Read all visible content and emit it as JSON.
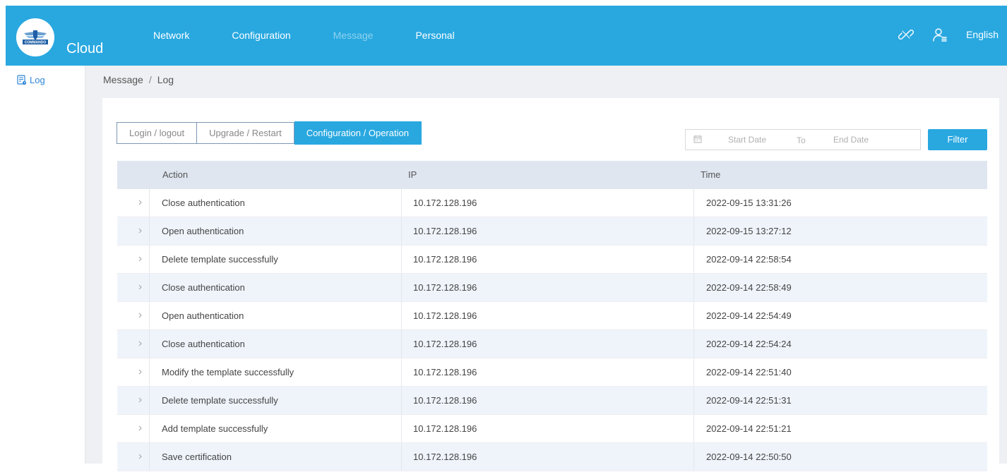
{
  "header": {
    "brand": "Cloud",
    "logo_text": "COMMANDO",
    "nav": [
      {
        "label": "Network",
        "dim": false
      },
      {
        "label": "Configuration",
        "dim": false
      },
      {
        "label": "Message",
        "dim": true
      },
      {
        "label": "Personal",
        "dim": false
      }
    ],
    "icons": [
      "link-icon",
      "user-icon"
    ],
    "language": "English",
    "accent_color": "#29a8e0"
  },
  "sidebar": {
    "items": [
      {
        "label": "Log",
        "icon": "log-icon"
      }
    ]
  },
  "breadcrumb": {
    "root": "Message",
    "separator": "/",
    "current": "Log"
  },
  "tabs": [
    {
      "label": "Login / logout",
      "active": false
    },
    {
      "label": "Upgrade / Restart",
      "active": false
    },
    {
      "label": "Configuration / Operation",
      "active": true
    }
  ],
  "date_filter": {
    "start_placeholder": "Start Date",
    "to_label": "To",
    "end_placeholder": "End Date",
    "filter_label": "Filter"
  },
  "table": {
    "columns": [
      "Action",
      "IP",
      "Time"
    ],
    "rows": [
      {
        "action": "Close authentication",
        "ip": "10.172.128.196",
        "time": "2022-09-15 13:31:26"
      },
      {
        "action": "Open authentication",
        "ip": "10.172.128.196",
        "time": "2022-09-15 13:27:12"
      },
      {
        "action": "Delete template successfully",
        "ip": "10.172.128.196",
        "time": "2022-09-14 22:58:54"
      },
      {
        "action": "Close authentication",
        "ip": "10.172.128.196",
        "time": "2022-09-14 22:58:49"
      },
      {
        "action": "Open authentication",
        "ip": "10.172.128.196",
        "time": "2022-09-14 22:54:49"
      },
      {
        "action": "Close authentication",
        "ip": "10.172.128.196",
        "time": "2022-09-14 22:54:24"
      },
      {
        "action": "Modify the template successfully",
        "ip": "10.172.128.196",
        "time": "2022-09-14 22:51:40"
      },
      {
        "action": "Delete template successfully",
        "ip": "10.172.128.196",
        "time": "2022-09-14 22:51:31"
      },
      {
        "action": "Add template successfully",
        "ip": "10.172.128.196",
        "time": "2022-09-14 22:51:21"
      },
      {
        "action": "Save certification",
        "ip": "10.172.128.196",
        "time": "2022-09-14 22:50:50"
      }
    ]
  }
}
